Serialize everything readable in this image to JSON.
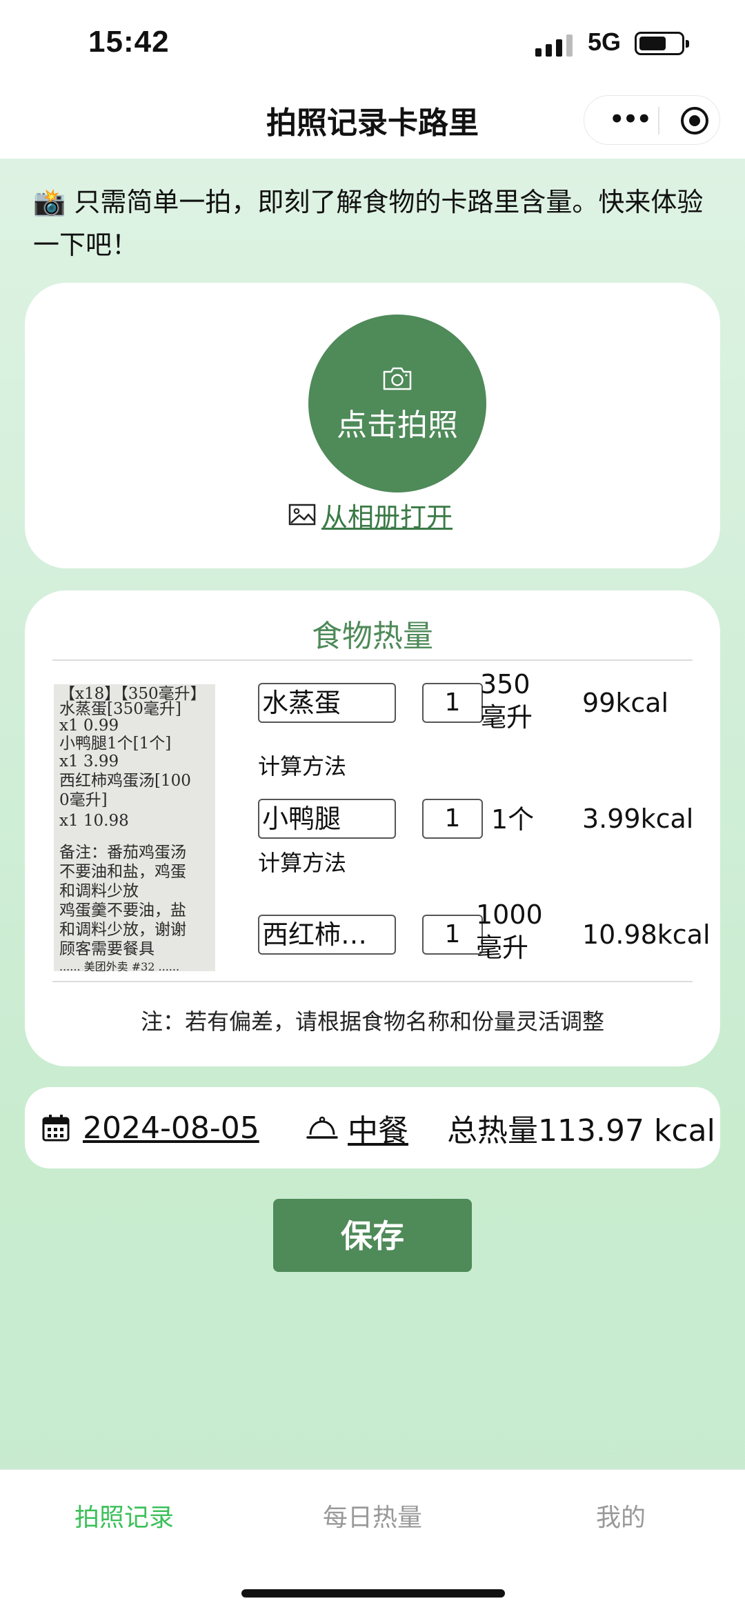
{
  "status_bar": {
    "time": "15:42",
    "network": "5G"
  },
  "nav": {
    "title": "拍照记录卡路里",
    "more_icon": "ellipsis-icon",
    "close_icon": "target-circle-icon"
  },
  "intro": {
    "emoji": "📸",
    "text": "只需简单一拍，即刻了解食物的卡路里含量。快来体验一下吧！"
  },
  "capture": {
    "camera_label": "点击拍照",
    "album_label": "从相册打开"
  },
  "food_section": {
    "title": "食物热量",
    "receipt_lines": [
      "【x18】【350毫升】",
      "水蒸蛋[350毫升]",
      "          x1    0.99",
      "小鸭腿1个[1个]",
      "        x1     3.99",
      "西红柿鸡蛋汤[100",
      "0毫升]",
      "       x1    10.98",
      "",
      "备注：番茄鸡蛋汤",
      "不要油和盐，鸡蛋",
      "和调料少放",
      "鸡蛋羹不要油，盐",
      "和调料少放，谢谢",
      "  顾客需要餐具",
      "  ...... 美团外卖 #32 ......"
    ],
    "items": [
      {
        "name": "水蒸蛋",
        "qty": "1",
        "portion": "350毫升",
        "kcal": "99kcal",
        "method": "计算方法"
      },
      {
        "name": "小鸭腿",
        "qty": "1",
        "portion": "1个",
        "kcal": "3.99kcal",
        "method": "计算方法"
      },
      {
        "name": "西红柿…",
        "qty": "1",
        "portion": "1000毫升",
        "kcal": "10.98kcal"
      }
    ],
    "note": "注：若有偏差，请根据食物名称和份量灵活调整"
  },
  "summary": {
    "date": "2024-08-05",
    "meal": "中餐",
    "total": "总热量113.97 kcal"
  },
  "save_label": "保存",
  "tabs": [
    {
      "label": "拍照记录",
      "active": true
    },
    {
      "label": "每日热量",
      "active": false
    },
    {
      "label": "我的",
      "active": false
    }
  ],
  "colors": {
    "primary": "#4f8a59",
    "tab_active": "#3cc05a",
    "tab_inactive": "#999999",
    "bg_green": "#d4efdb"
  }
}
